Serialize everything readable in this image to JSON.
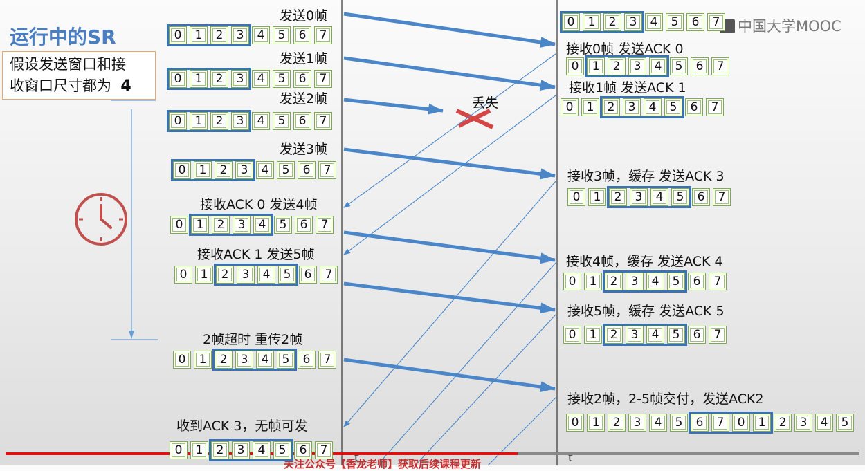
{
  "title": "运行中的SR",
  "assumption": {
    "line1": "假设发送窗口和接",
    "line2": "收窗口尺寸都为",
    "size": "4"
  },
  "watermark": "中国大学MOOC",
  "lost_label": "丢失",
  "time_label": "t",
  "bottom_caption": "关注公众号【香龙老师】获取后续课程更新",
  "progress_fraction": 0.6,
  "colors": {
    "arrow": "#4a86c8",
    "window": "#3a72b4",
    "cell_border": "#7aac4a",
    "lost_mark": "#d64545",
    "title": "#4a7ec3"
  },
  "sender_events": [
    {
      "label": "发送0帧",
      "digits": [
        "0",
        "1",
        "2",
        "3",
        "4",
        "5",
        "6",
        "7"
      ]
    },
    {
      "label": "发送1帧",
      "digits": [
        "0",
        "1",
        "2",
        "3",
        "4",
        "5",
        "6",
        "7"
      ]
    },
    {
      "label": "发送2帧",
      "digits": [
        "0",
        "1",
        "2",
        "3",
        "4",
        "5",
        "6",
        "7"
      ]
    },
    {
      "label": "发送3帧",
      "digits": [
        "0",
        "1",
        "2",
        "3",
        "4",
        "5",
        "6",
        "7"
      ]
    },
    {
      "label": "接收ACK 0  发送4帧",
      "digits": [
        "0",
        "1",
        "2",
        "3",
        "4",
        "5",
        "6",
        "7"
      ]
    },
    {
      "label": "接收ACK 1   发送5帧",
      "digits": [
        "0",
        "1",
        "2",
        "3",
        "4",
        "5",
        "6",
        "7"
      ]
    },
    {
      "label": "2帧超时   重传2帧",
      "digits": [
        "0",
        "1",
        "2",
        "3",
        "4",
        "5",
        "6",
        "7"
      ]
    },
    {
      "label": "收到ACK 3，无帧可发",
      "digits": [
        "0",
        "1",
        "2",
        "3",
        "4",
        "5",
        "6",
        "7"
      ]
    }
  ],
  "receiver_events": [
    {
      "label": "",
      "digits": [
        "0",
        "1",
        "2",
        "3",
        "4",
        "5",
        "6",
        "7"
      ]
    },
    {
      "label": "接收0帧 发送ACK 0",
      "digits": [
        "0",
        "1",
        "2",
        "3",
        "4",
        "5",
        "6",
        "7"
      ]
    },
    {
      "label": "接收1帧 发送ACK 1",
      "digits": [
        "0",
        "1",
        "2",
        "3",
        "4",
        "5",
        "6",
        "7"
      ]
    },
    {
      "label": "接收3帧，缓存  发送ACK 3",
      "digits": [
        "0",
        "1",
        "2",
        "3",
        "4",
        "5",
        "6",
        "7"
      ]
    },
    {
      "label": "接收4帧，缓存  发送ACK 4",
      "digits": [
        "0",
        "1",
        "2",
        "3",
        "4",
        "5",
        "6",
        "7"
      ]
    },
    {
      "label": "接收5帧，缓存  发送ACK 5",
      "digits": [
        "0",
        "1",
        "2",
        "3",
        "4",
        "5",
        "6",
        "7"
      ]
    },
    {
      "label": "接收2帧，2-5帧交付，发送ACK2",
      "digits": [
        "0",
        "1",
        "2",
        "3",
        "4",
        "5",
        "6",
        "7",
        "0",
        "1",
        "2",
        "3",
        "4",
        "5"
      ]
    }
  ]
}
